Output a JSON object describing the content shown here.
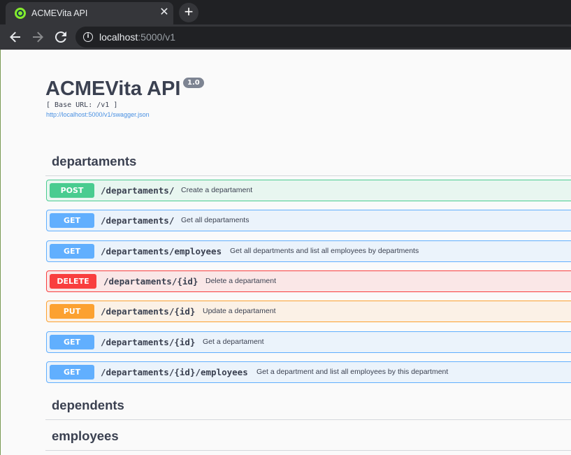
{
  "browser": {
    "tab_title": "ACMEVita API",
    "tab_close": "✕",
    "new_tab": "+",
    "url_host": "localhost",
    "url_path": ":5000/v1"
  },
  "info": {
    "title": "ACMEVita API",
    "version": "1.0",
    "base_url": "[ Base URL: /v1 ]",
    "spec_link": "http://localhost:5000/v1/swagger.json"
  },
  "tags": [
    {
      "name": "departaments",
      "operations": [
        {
          "method": "POST",
          "path": "/departaments/",
          "summary": "Create a departament"
        },
        {
          "method": "GET",
          "path": "/departaments/",
          "summary": "Get all departaments"
        },
        {
          "method": "GET",
          "path": "/departaments/employees",
          "summary": "Get all departments and list all employees by departments"
        },
        {
          "method": "DELETE",
          "path": "/departaments/{id}",
          "summary": "Delete a departament"
        },
        {
          "method": "PUT",
          "path": "/departaments/{id}",
          "summary": "Update a departament"
        },
        {
          "method": "GET",
          "path": "/departaments/{id}",
          "summary": "Get a departament"
        },
        {
          "method": "GET",
          "path": "/departaments/{id}/employees",
          "summary": "Get a department and list all employees by this department"
        }
      ]
    },
    {
      "name": "dependents",
      "operations": []
    },
    {
      "name": "employees",
      "operations": []
    }
  ],
  "colors": {
    "post": "#49cc90",
    "get": "#61affe",
    "delete": "#f93e3e",
    "put": "#fca130"
  }
}
